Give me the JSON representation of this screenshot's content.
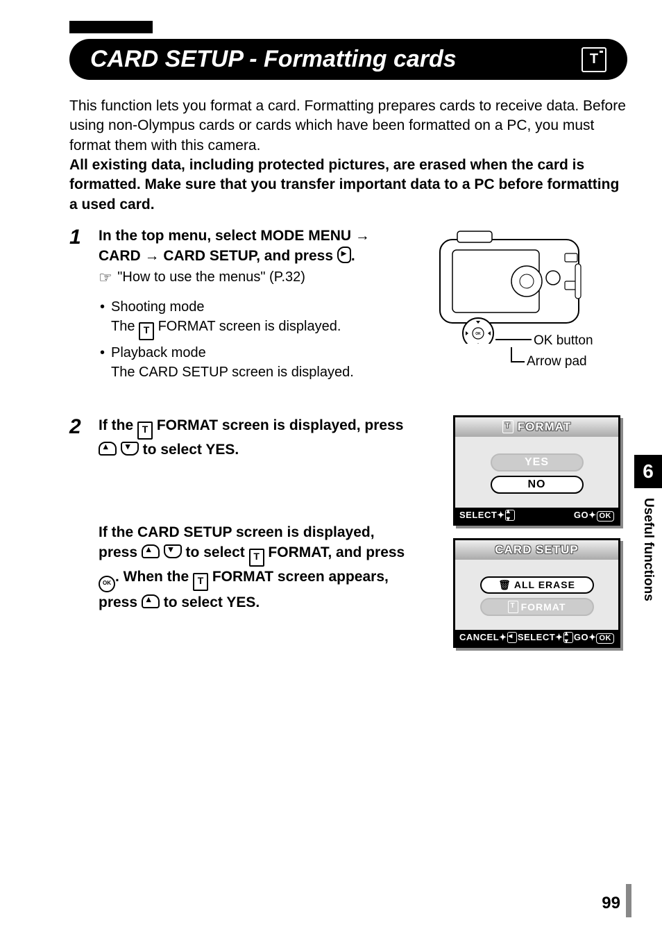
{
  "title": "CARD SETUP - Formatting cards",
  "intro": {
    "text": "This function lets you format a card. Formatting prepares cards to receive data. Before using non-Olympus cards or cards which have been formatted on a PC, you must format them with this camera.",
    "warning": "All existing data, including protected pictures, are erased when the card is formatted. Make sure that you  transfer important data to a PC before formatting a used card."
  },
  "steps": [
    {
      "num": "1",
      "main_pre": "In the top menu, select MODE MENU ",
      "main_mid1": " CARD ",
      "main_mid2": " CARD SETUP, and press ",
      "main_post": ".",
      "ref": " \"How to use the menus\" (P.32)",
      "bullets": [
        {
          "title": "Shooting mode",
          "sub_pre": "The ",
          "sub_post": " FORMAT screen is displayed."
        },
        {
          "title": "Playback mode",
          "sub": "The CARD SETUP screen is displayed."
        }
      ],
      "callouts": {
        "ok": "OK button",
        "arrow": "Arrow pad"
      }
    },
    {
      "num": "2",
      "main_a_pre": "If the ",
      "main_a_mid1": " FORMAT screen is displayed, press ",
      "main_a_post": " to select YES.",
      "main_b_pre": "If the CARD SETUP screen is displayed, press ",
      "main_b_mid1": " to select ",
      "main_b_mid2": " FORMAT, and press ",
      "main_b_mid3": ". When the ",
      "main_b_mid4": " FORMAT screen appears, press ",
      "main_b_post": " to select YES."
    }
  ],
  "screens": {
    "format": {
      "header": "FORMAT",
      "yes": "YES",
      "no": "NO",
      "footer_select": "SELECT",
      "footer_go": "GO",
      "footer_ok": "OK"
    },
    "cardsetup": {
      "header": "CARD SETUP",
      "erase": "ALL ERASE",
      "format": "FORMAT",
      "footer_cancel": "CANCEL",
      "footer_select": "SELECT",
      "footer_go": "GO",
      "footer_ok": "OK"
    }
  },
  "sidetab": {
    "num": "6",
    "label": "Useful functions"
  },
  "pagenum": "99"
}
